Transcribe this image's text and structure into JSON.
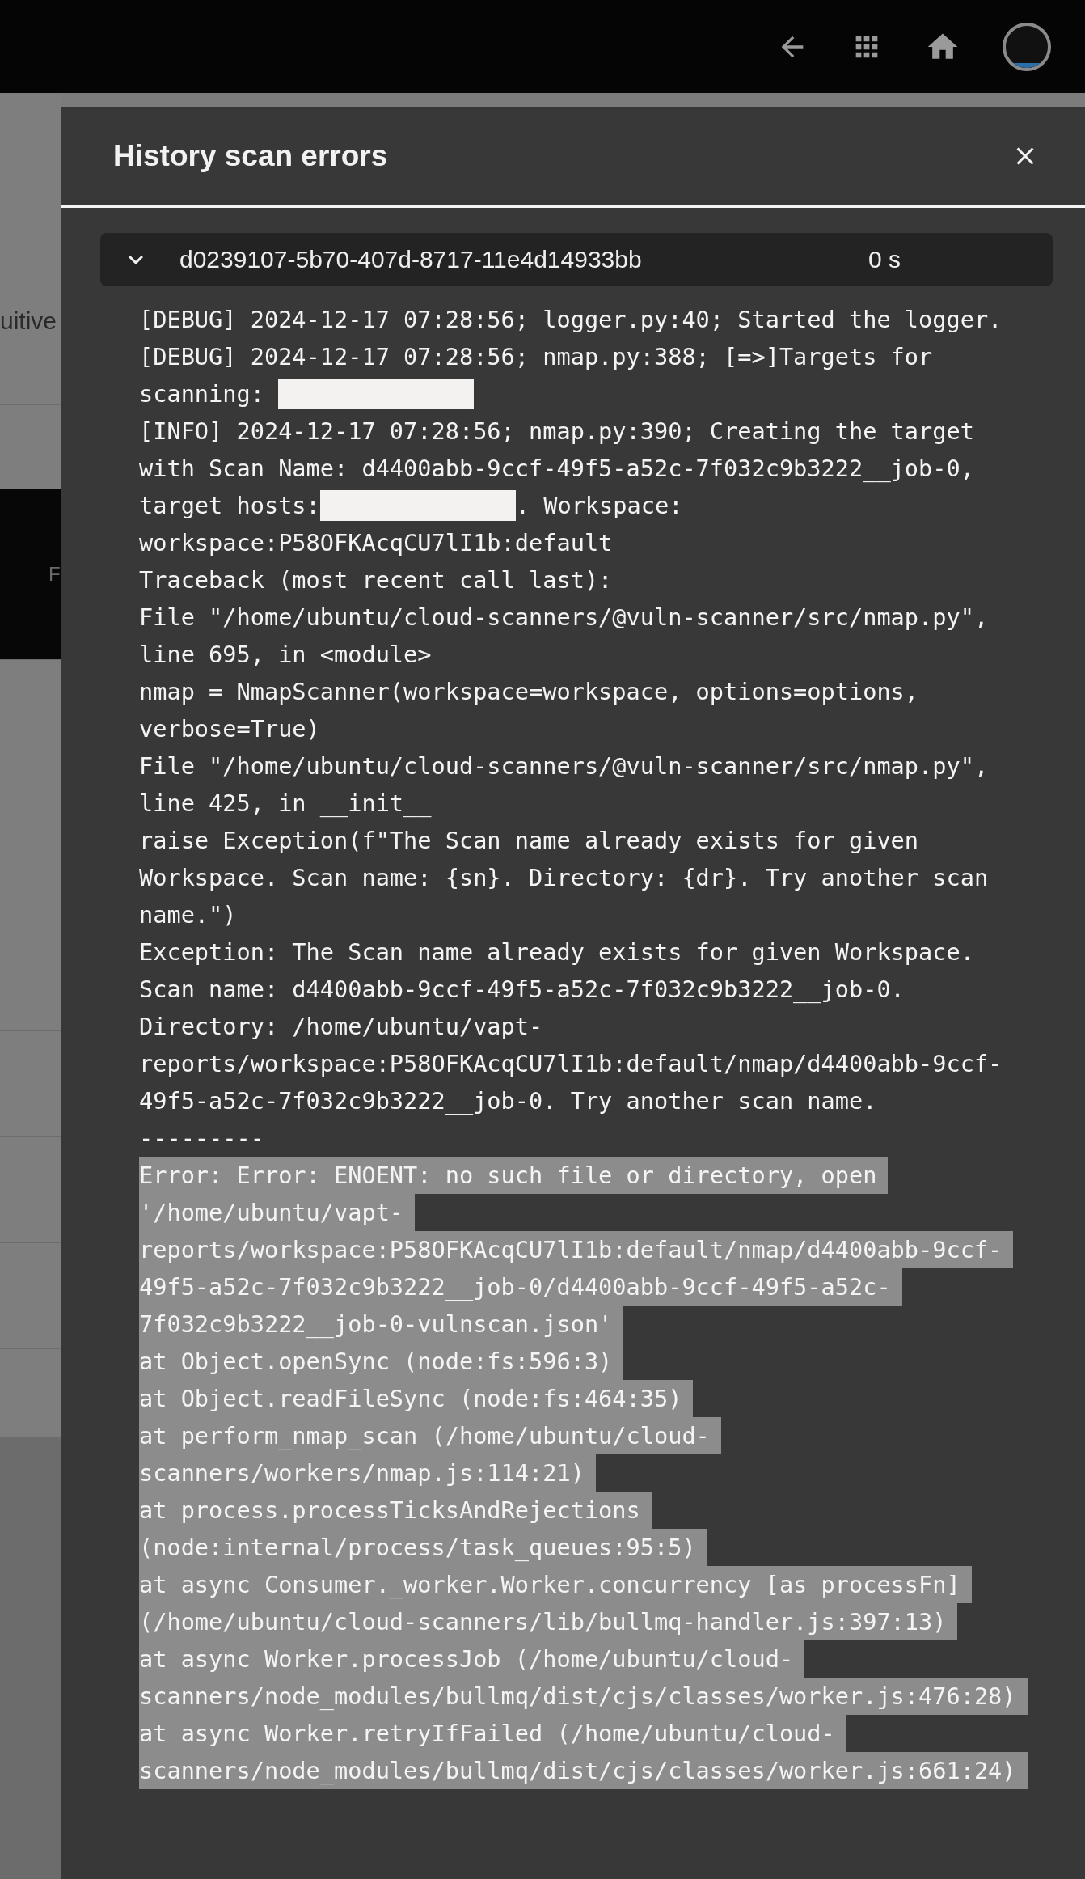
{
  "background_page": {
    "text_fragment": "uitive",
    "band_fragment": "F"
  },
  "dialog": {
    "title": "History scan errors",
    "scan": {
      "expanded": true,
      "id": "d0239107-5b70-407d-8717-11e4d14933bb",
      "duration": "0 s",
      "log_lines": [
        {
          "text": "[DEBUG] 2024-12-17 07:28:56; logger.py:40; Started the logger.",
          "selected": false
        },
        {
          "text": "[DEBUG] 2024-12-17 07:28:56; nmap.py:388; [=>]Targets for",
          "selected": false
        },
        {
          "text": "scanning: ",
          "redacted": true,
          "selected": false
        },
        {
          "text": "[INFO] 2024-12-17 07:28:56; nmap.py:390; Creating the target",
          "selected": false
        },
        {
          "text": "with Scan Name: d4400abb-9ccf-49f5-a52c-7f032c9b3222__job-0,",
          "selected": false
        },
        {
          "text": "target hosts:",
          "redacted": true,
          "rest": ". Workspace:",
          "selected": false
        },
        {
          "text": "workspace:P58OFKAcqCU7lI1b:default",
          "selected": false
        },
        {
          "text": "Traceback (most recent call last):",
          "selected": false
        },
        {
          "text": "File \"/home/ubuntu/cloud-scanners/@vuln-scanner/src/nmap.py\",",
          "selected": false
        },
        {
          "text": "line 695, in <module>",
          "selected": false
        },
        {
          "text": "nmap = NmapScanner(workspace=workspace, options=options,",
          "selected": false
        },
        {
          "text": "verbose=True)",
          "selected": false
        },
        {
          "text": "File \"/home/ubuntu/cloud-scanners/@vuln-scanner/src/nmap.py\",",
          "selected": false
        },
        {
          "text": "line 425, in __init__",
          "selected": false
        },
        {
          "text": "raise Exception(f\"The Scan name already exists for given",
          "selected": false
        },
        {
          "text": "Workspace. Scan name: {sn}. Directory: {dr}. Try another scan",
          "selected": false
        },
        {
          "text": "name.\")",
          "selected": false
        },
        {
          "text": "Exception: The Scan name already exists for given Workspace.",
          "selected": false
        },
        {
          "text": "Scan name: d4400abb-9ccf-49f5-a52c-7f032c9b3222__job-0.",
          "selected": false
        },
        {
          "text": "Directory: /home/ubuntu/vapt-",
          "selected": false
        },
        {
          "text": "reports/workspace:P58OFKAcqCU7lI1b:default/nmap/d4400abb-9ccf-",
          "selected": false
        },
        {
          "text": "49f5-a52c-7f032c9b3222__job-0. Try another scan name.",
          "selected": false
        },
        {
          "text": "---------",
          "selected": false
        },
        {
          "text": "Error: Error: ENOENT: no such file or directory, open",
          "selected": true
        },
        {
          "text": "'/home/ubuntu/vapt-",
          "selected": true
        },
        {
          "text": "reports/workspace:P58OFKAcqCU7lI1b:default/nmap/d4400abb-9ccf-",
          "selected": true
        },
        {
          "text": "49f5-a52c-7f032c9b3222__job-0/d4400abb-9ccf-49f5-a52c-",
          "selected": true
        },
        {
          "text": "7f032c9b3222__job-0-vulnscan.json'",
          "selected": true
        },
        {
          "text": "at Object.openSync (node:fs:596:3)",
          "selected": true
        },
        {
          "text": "at Object.readFileSync (node:fs:464:35)",
          "selected": true
        },
        {
          "text": "at perform_nmap_scan (/home/ubuntu/cloud-",
          "selected": true
        },
        {
          "text": "scanners/workers/nmap.js:114:21)",
          "selected": true
        },
        {
          "text": "at process.processTicksAndRejections",
          "selected": true
        },
        {
          "text": "(node:internal/process/task_queues:95:5)",
          "selected": true
        },
        {
          "text": "at async Consumer._worker.Worker.concurrency [as processFn]",
          "selected": true
        },
        {
          "text": "(/home/ubuntu/cloud-scanners/lib/bullmq-handler.js:397:13)",
          "selected": true
        },
        {
          "text": "at async Worker.processJob (/home/ubuntu/cloud-",
          "selected": true
        },
        {
          "text": "scanners/node_modules/bullmq/dist/cjs/classes/worker.js:476:28)",
          "selected": true
        },
        {
          "text": "at async Worker.retryIfFailed (/home/ubuntu/cloud-",
          "selected": true
        },
        {
          "text": "scanners/node_modules/bullmq/dist/cjs/classes/worker.js:661:24)",
          "selected": true
        }
      ]
    }
  }
}
